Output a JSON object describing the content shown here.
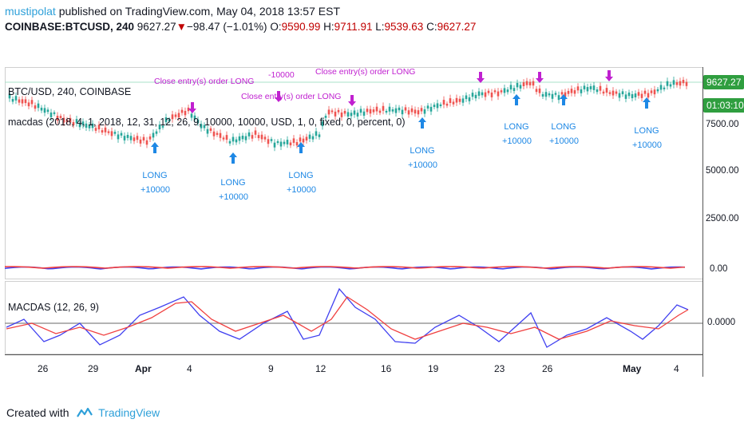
{
  "header": {
    "author": "mustipolat",
    "published_text": " published on TradingView.com, May 04, 2018 13:57 EST",
    "symbol": "COINBASE:BTCUSD, 240",
    "last": "9627.27",
    "change": "−98.47 (−1.01%)",
    "o_label": "O:",
    "o_value": "9590.99",
    "h_label": "H:",
    "h_value": "9711.91",
    "l_label": "L:",
    "l_value": "9539.63",
    "c_label": "C:",
    "c_value": "9627.27"
  },
  "main_pane": {
    "title": "BTC/USD, 240, COINBASE",
    "study": "macdas (2018, 4, 1, 2018, 12, 31, 12, 26, 9, 10000, 10000, USD, 1, 0, fixed, 0, percent, 0)",
    "long_label": "LONG",
    "long_amount": "+10000",
    "close_label": "Close entry(s) order LONG",
    "close_amount": "-10000"
  },
  "osc_pane": {
    "title": "MACDAS (12, 26, 9)"
  },
  "price_axis": {
    "labels": [
      "7500.00",
      "5000.00",
      "2500.00",
      "0.00",
      "0.0000"
    ],
    "price_badge": "9627.27",
    "time_badge": "01:03:10"
  },
  "time_axis": {
    "labels": [
      "26",
      "29",
      "Apr",
      "4",
      "9",
      "12",
      "16",
      "19",
      "23",
      "26",
      "May",
      "4"
    ]
  },
  "colors": {
    "up": "#26a69a",
    "down": "#ef5350",
    "long": "#1e88e5",
    "close": "#c020d0",
    "macd": "#3f3ff0",
    "signal": "#f04040",
    "price_badge": "#2f9e3f"
  },
  "footer": {
    "created_with": "Created with",
    "brand": "TradingView"
  }
}
